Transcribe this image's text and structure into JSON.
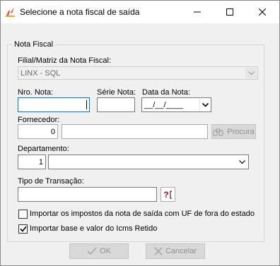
{
  "window": {
    "title": "Selecione a nota fiscal de saída",
    "icons": {
      "app": "linx-red-logo-icon",
      "minimize": "minimize-icon",
      "maximize": "maximize-icon",
      "close": "close-icon"
    }
  },
  "group": {
    "title": "Nota Fiscal"
  },
  "filial": {
    "label": "Filial/Matriz da Nota Fiscal:",
    "value": "LINX - SQL"
  },
  "nro_nota": {
    "label": "Nro. Nota:",
    "value": ""
  },
  "serie_nota": {
    "label": "Série Nota:",
    "value": ""
  },
  "data_nota": {
    "label": "Data da Nota:",
    "value": "__/__/____"
  },
  "fornecedor": {
    "label": "Fornecedor:",
    "code": "0",
    "name": "",
    "search_button": "Procura"
  },
  "departamento": {
    "label": "Departamento:",
    "code": "1",
    "name": ""
  },
  "tipo_transacao": {
    "label": "Tipo de Transação:",
    "value": "",
    "help_icon": "?"
  },
  "options": {
    "import_taxes": {
      "label": "Importar os impostos da nota de saída com UF de fora do estado",
      "checked": false
    },
    "import_icms": {
      "label": "Importar base e valor do Icms Retido",
      "checked": true
    }
  },
  "buttons": {
    "ok": "OK",
    "cancel": "Cancelar"
  },
  "colors": {
    "accent": "#0078d7",
    "logo": "#e8451e"
  }
}
